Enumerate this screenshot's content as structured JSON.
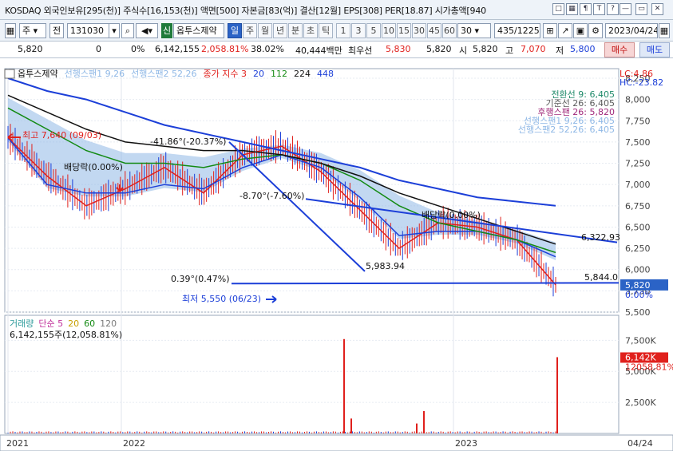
{
  "info_bar": {
    "text": "KOSDAQ 외국인보유[295(천)] 주식수[16,153(천)] 액면[500] 자본금[83(억)] 결산[12월] EPS[308] PER[18.87] 시가총액[940",
    "icons": [
      "window-icon",
      "grid-icon",
      "pin-icon",
      "text-icon",
      "help-icon",
      "minimize-icon",
      "restore-icon",
      "close-icon"
    ],
    "icon_labels": [
      "□",
      "▦",
      "¶",
      "T",
      "?",
      "—",
      "▭",
      "✕"
    ]
  },
  "toolbar": {
    "type_select": "주",
    "type_btn": "전",
    "code": "131030",
    "market_badge": "신",
    "stock_name": "옵투스제약",
    "periods": [
      "일",
      "주",
      "월",
      "년",
      "분",
      "초",
      "틱"
    ],
    "selected_period": "일",
    "intervals": [
      "1",
      "3",
      "5",
      "10",
      "15",
      "30",
      "45",
      "60"
    ],
    "interval_select": "30",
    "page_count": "435",
    "page_total": "/1225",
    "date": "2023/04/24"
  },
  "quote": {
    "price": "5,820",
    "change": "0",
    "change_pct": "0%",
    "volume": "6,142,155",
    "volume_ratio": "2,058.81%",
    "turnover": "38.02%",
    "amount": "40,444백만",
    "sell_label": "최우선",
    "best_ask": "5,830",
    "best_bid": "5,820",
    "open_label": "시",
    "open": "5,820",
    "high_label": "고",
    "high": "7,070",
    "low_label": "저",
    "low": "5,800",
    "buy_button": "매수",
    "sell_button": "매도"
  },
  "price_pane": {
    "legend": [
      {
        "text": "옵투스제약",
        "color": "#111111"
      },
      {
        "text": "선행스팬1 9,26",
        "color": "#8fb8e6"
      },
      {
        "text": "선행스팬2 52,26",
        "color": "#8fb8e6"
      },
      {
        "text": "종가 지수 3",
        "color": "#e0201c"
      },
      {
        "text": "20",
        "color": "#1c3fd8"
      },
      {
        "text": "112",
        "color": "#138a13"
      },
      {
        "text": "224",
        "color": "#111111"
      },
      {
        "text": "448",
        "color": "#1c3fd8"
      }
    ],
    "lc": "LC:4.86",
    "hc": "HC:-23.82",
    "ichimoku_labels": [
      {
        "text": "전환선 9: 6,405",
        "color": "#1f8a6a"
      },
      {
        "text": "기준선 26: 6,405",
        "color": "#5a5a5a"
      },
      {
        "text": "후행스팬 26: 5,820",
        "color": "#a0287a"
      },
      {
        "text": "선행스팬1 9,26: 6,405",
        "color": "#8fb8e6"
      },
      {
        "text": "선행스팬2 52,26: 6,405",
        "color": "#8fb8e6"
      }
    ],
    "annotations": [
      {
        "text": "최고 7,640 (09/03)",
        "color": "#e0201c"
      },
      {
        "text": "최저 5,550 (06/23)",
        "color": "#1c3fd8"
      },
      {
        "text": "배당락(0.00%)",
        "color": "#111111"
      },
      {
        "text": "배당락(0.00%)",
        "color": "#111111"
      },
      {
        "text": "-41.86°(-20.37%)",
        "color": "#111111"
      },
      {
        "text": "-8.70°(-7.60%)",
        "color": "#111111"
      },
      {
        "text": "5,983.94",
        "color": "#111111"
      },
      {
        "text": "0.39°(0.47%)",
        "color": "#111111"
      },
      {
        "text": "6,322.93",
        "color": "#111111"
      },
      {
        "text": "5,844.0",
        "color": "#111111"
      }
    ],
    "price_tag": "5,820",
    "price_tag_pct": "0.00%"
  },
  "volume_pane": {
    "legend": [
      {
        "text": "거래량",
        "color": "#2b9a9a"
      },
      {
        "text": "단순 5",
        "color": "#c0309a"
      },
      {
        "text": "20",
        "color": "#c8a000"
      },
      {
        "text": "60",
        "color": "#138a13"
      },
      {
        "text": "120",
        "color": "#7a7a7a"
      }
    ],
    "value_text": "6,142,155주(12,058.81%)",
    "tag": "6,142K",
    "tag_pct": "12058.81%"
  },
  "date_axis": [
    "2021",
    "2022",
    "2023",
    "04/24"
  ],
  "chart_data": [
    {
      "type": "line",
      "name": "price",
      "ylim": [
        5500,
        8250
      ],
      "yticks": [
        5500,
        5750,
        6000,
        6250,
        6500,
        6750,
        7000,
        7250,
        7500,
        7750,
        8000,
        8250
      ],
      "x_dates": [
        "2021-01",
        "2021-03",
        "2021-05",
        "2021-07",
        "2021-09",
        "2021-11",
        "2022-01",
        "2022-03",
        "2022-05",
        "2022-07",
        "2022-09",
        "2022-11",
        "2023-01",
        "2023-03",
        "2023-04-24"
      ],
      "series": [
        {
          "name": "종가 지수 3",
          "color": "#e0201c",
          "values": [
            7550,
            7100,
            6750,
            6950,
            7200,
            6900,
            7350,
            7450,
            7150,
            6700,
            6250,
            6550,
            6500,
            6350,
            5820
          ]
        },
        {
          "name": "20",
          "color": "#1c3fd8",
          "values": [
            7550,
            7000,
            6900,
            6900,
            7000,
            6950,
            7200,
            7350,
            7200,
            6850,
            6400,
            6450,
            6450,
            6350,
            6150
          ]
        },
        {
          "name": "112",
          "color": "#138a13",
          "values": [
            7900,
            7650,
            7400,
            7250,
            7250,
            7200,
            7300,
            7350,
            7250,
            7050,
            6750,
            6550,
            6450,
            6350,
            6200
          ]
        },
        {
          "name": "224",
          "color": "#111111",
          "values": [
            8050,
            7850,
            7650,
            7500,
            7450,
            7400,
            7400,
            7350,
            7250,
            7100,
            6900,
            6750,
            6600,
            6450,
            6300
          ]
        },
        {
          "name": "448",
          "color": "#1c3fd8",
          "values": [
            8250,
            8100,
            8000,
            7850,
            7700,
            7600,
            7500,
            7400,
            7300,
            7200,
            7050,
            6950,
            6850,
            6800,
            6750
          ]
        }
      ]
    },
    {
      "type": "bar",
      "name": "volume",
      "ylim": [
        0,
        9000
      ],
      "yticks": [
        2500,
        5000,
        7500
      ],
      "unit": "K",
      "spikes": [
        {
          "date": "2022-09",
          "value": 7600
        },
        {
          "date": "2022-10",
          "value": 1200
        },
        {
          "date": "2023-01",
          "value": 1800
        },
        {
          "date": "2023-01",
          "value": 800
        },
        {
          "date": "2023-04-24",
          "value": 6142
        }
      ]
    }
  ]
}
